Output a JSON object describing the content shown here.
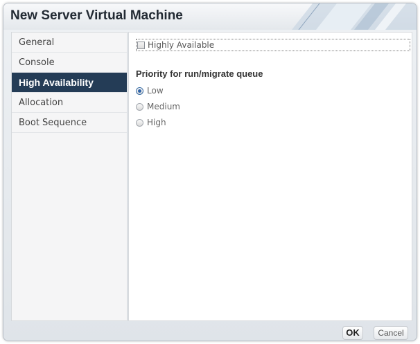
{
  "dialog": {
    "title": "New Server Virtual Machine"
  },
  "sidebar": {
    "items": [
      {
        "label": "General",
        "selected": false
      },
      {
        "label": "Console",
        "selected": false
      },
      {
        "label": "High Availability",
        "selected": true
      },
      {
        "label": "Allocation",
        "selected": false
      },
      {
        "label": "Boot Sequence",
        "selected": false
      }
    ]
  },
  "content": {
    "highly_available": {
      "label": "Highly Available",
      "checked": false
    },
    "priority": {
      "title": "Priority for run/migrate queue",
      "options": [
        {
          "label": "Low",
          "checked": true
        },
        {
          "label": "Medium",
          "checked": false
        },
        {
          "label": "High",
          "checked": false
        }
      ]
    }
  },
  "footer": {
    "ok_label": "OK",
    "cancel_label": "Cancel"
  }
}
